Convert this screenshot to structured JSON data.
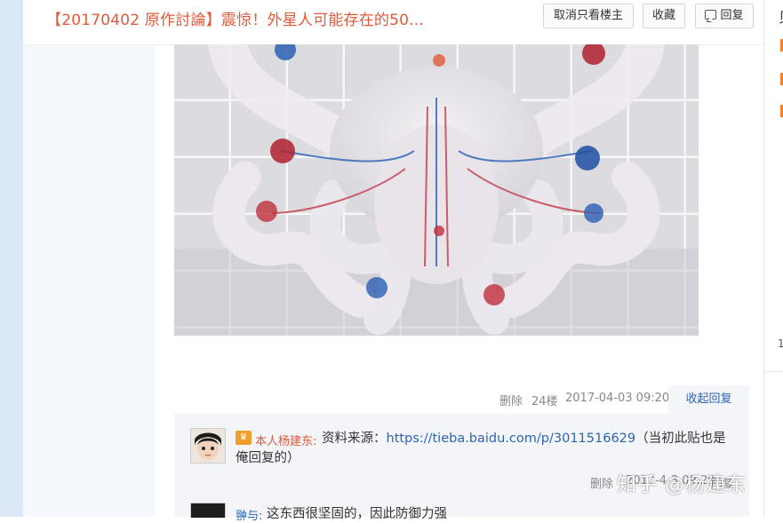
{
  "header": {
    "thread_title": "【20170402 原作討論】震惊！外星人可能存在的50...",
    "only_op_button": "取消只看楼主",
    "favorite_button": "收藏",
    "reply_button": "回复"
  },
  "sidebar_right": {
    "title_fragment": "贝",
    "count_fragment": "1",
    "accent_color": "#f0822d"
  },
  "post": {
    "image_subject": "translucent octopus-like specimen with red and blue veins",
    "delete_label": "删除",
    "floor": "24楼",
    "timestamp": "2017-04-03 09:20",
    "collapse_reply_label": "收起回复"
  },
  "replies": [
    {
      "badge_icon": "crown-icon",
      "author": "本人杨建东:",
      "text_prefix": "资料来源：",
      "link": "https://tieba.baidu.com/p/3011516629",
      "text_suffix": "（当初此贴也是",
      "text_line2": "俺回复的）",
      "delete_label": "删除",
      "timestamp": "2017-4-3 09:20",
      "reply_label": "回复"
    },
    {
      "author": "翀与:",
      "text": "这东西很坚固的，因此防御力强"
    }
  ],
  "watermark": "知乎 @杨建东",
  "colors": {
    "title_red": "#e05a3a",
    "link_blue": "#2d64b3",
    "reply_bg": "#f3f5f8"
  }
}
